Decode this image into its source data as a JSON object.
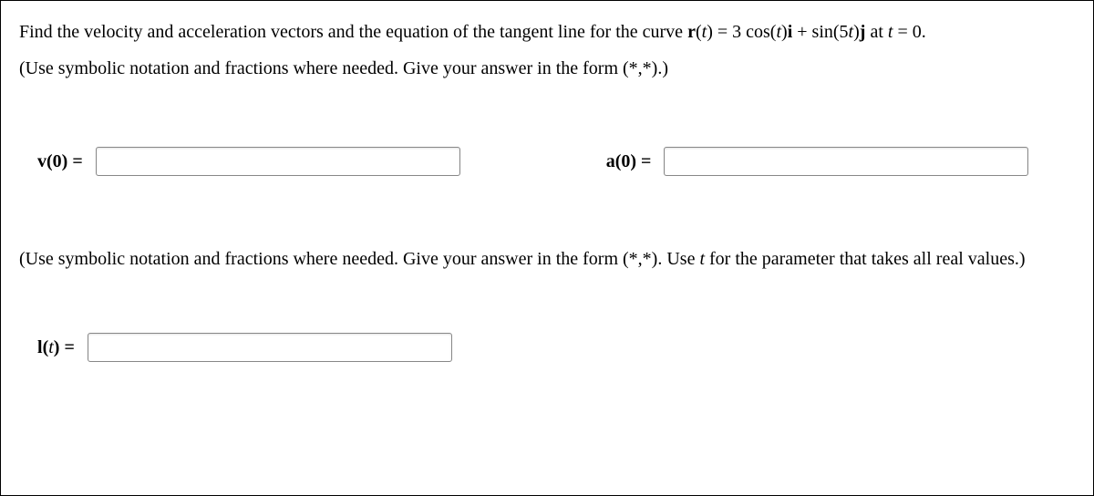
{
  "problem": {
    "text_part1": "Find the velocity and acceleration vectors and the equation of the tangent line for the curve ",
    "r_label": "r",
    "t_label": "t",
    "eq_part": "(",
    "func_text": ") = 3 cos(",
    "i_label": "i",
    "plus_text": " + sin(5",
    "j_label": "j",
    "at_text": " at ",
    "t_eq": " = 0.",
    "closing": ")"
  },
  "instruction1": "(Use symbolic notation and fractions where needed. Give your answer in the form (*,*).)",
  "labels": {
    "v": "v",
    "a": "a",
    "l": "l",
    "zero_eq": "(0) =",
    "t_eq": "(",
    "t_var": "t",
    "close_eq": ") ="
  },
  "instruction2_part1": "(Use symbolic notation and fractions where needed. Give your answer in the form (*,*). Use ",
  "instruction2_t": "t",
  "instruction2_part2": " for the parameter that takes all real values.)",
  "inputs": {
    "v_value": "",
    "a_value": "",
    "l_value": ""
  }
}
